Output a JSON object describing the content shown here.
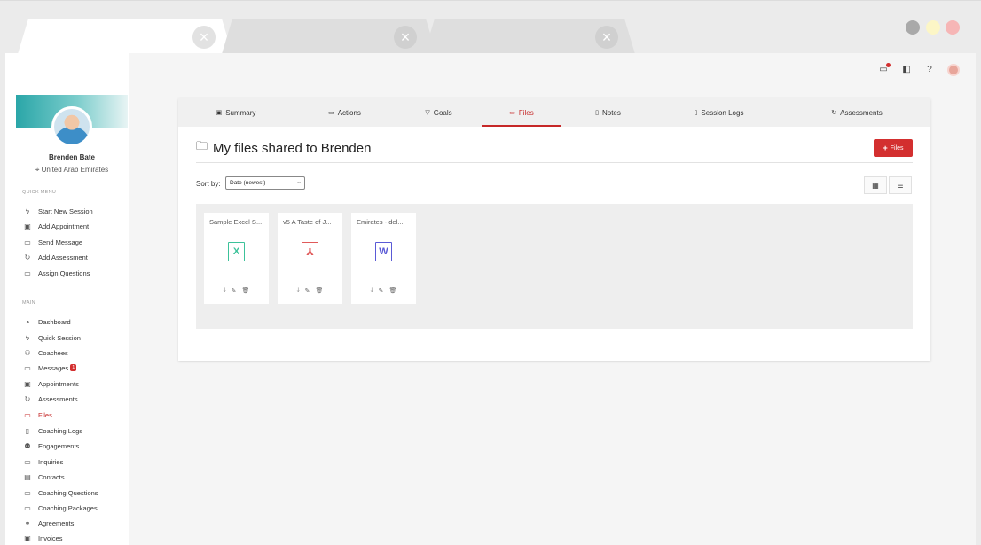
{
  "browser": {
    "tabs": [
      {
        "close_glyph": "×"
      },
      {
        "close_glyph": "×"
      },
      {
        "close_glyph": "×"
      }
    ]
  },
  "profile": {
    "name": "Brenden Bate",
    "location": "United Arab Emirates"
  },
  "quick_menu": {
    "label": "Quick Menu",
    "items": [
      {
        "label": "Start New Session",
        "icon": "lightning-icon"
      },
      {
        "label": "Add Appointment",
        "icon": "calendar-plus-icon"
      },
      {
        "label": "Send Message",
        "icon": "chat-icon"
      },
      {
        "label": "Add Assessment",
        "icon": "refresh-icon"
      },
      {
        "label": "Assign Questions",
        "icon": "question-chat-icon"
      }
    ]
  },
  "main_menu": {
    "label": "Main",
    "items": [
      {
        "label": "Dashboard",
        "icon": "dashboard-icon"
      },
      {
        "label": "Quick Session",
        "icon": "lightning-icon"
      },
      {
        "label": "Coachees",
        "icon": "user-icon"
      },
      {
        "label": "Messages",
        "icon": "chat-icon",
        "badge": "1"
      },
      {
        "label": "Appointments",
        "icon": "calendar-icon"
      },
      {
        "label": "Assessments",
        "icon": "refresh-icon"
      },
      {
        "label": "Files",
        "icon": "folder-icon",
        "active": true
      },
      {
        "label": "Coaching Logs",
        "icon": "log-icon"
      },
      {
        "label": "Engagements",
        "icon": "group-icon"
      },
      {
        "label": "Inquiries",
        "icon": "inquiry-icon"
      },
      {
        "label": "Contacts",
        "icon": "contacts-icon"
      },
      {
        "label": "Coaching Questions",
        "icon": "question-chat-icon"
      },
      {
        "label": "Coaching Packages",
        "icon": "package-icon"
      },
      {
        "label": "Agreements",
        "icon": "handshake-icon"
      },
      {
        "label": "Invoices",
        "icon": "invoice-icon"
      }
    ]
  },
  "tabs": [
    {
      "label": "Summary",
      "icon": "summary-icon"
    },
    {
      "label": "Actions",
      "icon": "clipboard-icon"
    },
    {
      "label": "Goals",
      "icon": "trophy-icon"
    },
    {
      "label": "Files",
      "icon": "folder-icon",
      "active": true
    },
    {
      "label": "Notes",
      "icon": "note-icon"
    },
    {
      "label": "Session Logs",
      "icon": "log-icon"
    },
    {
      "label": "Assessments",
      "icon": "refresh-icon"
    }
  ],
  "section": {
    "title": "My files shared to Brenden",
    "add_button": "Files"
  },
  "sort": {
    "label": "Sort by:",
    "selected": "Date (newest)"
  },
  "files": [
    {
      "name": "Sample Excel S...",
      "type": "excel",
      "glyph": "X"
    },
    {
      "name": "v5 A Taste of J...",
      "type": "pdf",
      "glyph": "⅄"
    },
    {
      "name": "Emirates - del...",
      "type": "word",
      "glyph": "W"
    }
  ],
  "colors": {
    "accent": "#c62828",
    "excel": "#3cc29a",
    "pdf": "#e05a5a",
    "word": "#5a5ad6"
  }
}
